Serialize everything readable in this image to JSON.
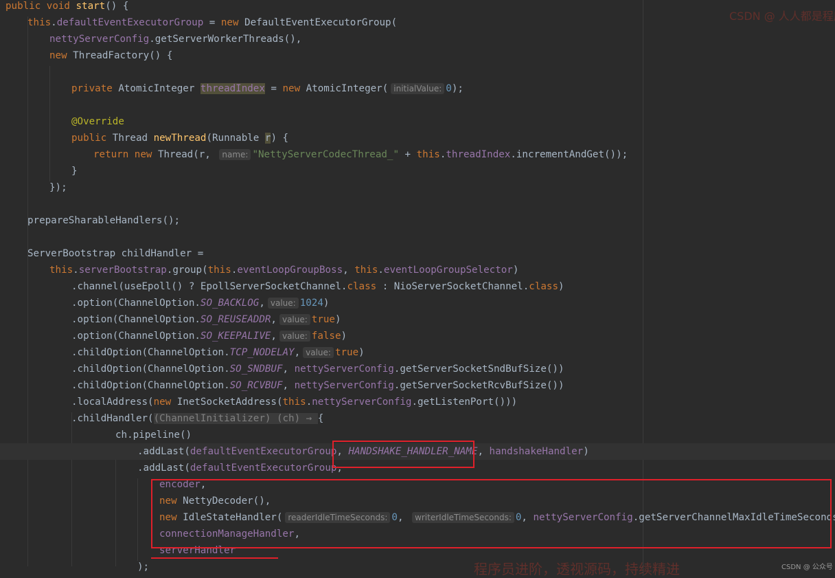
{
  "hints": {
    "initialValue": "initialValue:",
    "name": "name:",
    "value": "value:",
    "readerIdle": "readerIdleTimeSeconds:",
    "writerIdle": "writerIdleTimeSeconds:"
  },
  "tok": {
    "public": "public",
    "void": "void",
    "this": "this",
    "new": "new",
    "private": "private",
    "return": "return",
    "class": "class",
    "true": "true",
    "false": "false",
    "zero": "0",
    "n1024": "1024"
  },
  "code": {
    "l1": {
      "start": "start",
      "rest": "() {"
    },
    "l2": {
      "f": "defaultEventExecutorGroup",
      "mid": " = ",
      "rest": " DefaultEventExecutorGroup("
    },
    "l3": {
      "f": "nettyServerConfig",
      "rest": ".getServerWorkerThreads(),"
    },
    "l4": {
      "rest": " ThreadFactory() {"
    },
    "l6": {
      "type": " AtomicInteger ",
      "f": "threadIndex",
      "mid": " = ",
      "rest": " AtomicInteger(",
      "end": ");"
    },
    "l8": {
      "ann": "@Override"
    },
    "l9": {
      "type": " Thread ",
      "m": "newThread",
      "a": "(Runnable ",
      "r": "r",
      "b": ") {"
    },
    "l10": {
      "a": " Thread(r, ",
      "str": "\"NettyServerCodecThread_\"",
      "b": " + ",
      "f": "threadIndex",
      "c": ".incrementAndGet());"
    },
    "l11": {
      "t": "}"
    },
    "l12": {
      "t": "});"
    },
    "l14": {
      "t": "prepareSharableHandlers();"
    },
    "l16": {
      "t": "ServerBootstrap childHandler ="
    },
    "l17": {
      "f1": "serverBootstrap",
      "a": ".group(",
      "f2": "eventLoopGroupBoss",
      "b": ", ",
      "f3": "eventLoopGroupSelector",
      "c": ")"
    },
    "l18": {
      "a": ".channel(useEpoll() ? EpollServerSocketChannel.",
      "b": " : NioServerSocketChannel.",
      "c": ")"
    },
    "l19": {
      "a": ".option(ChannelOption.",
      "sf": "SO_BACKLOG",
      "b": ",",
      "c": ")"
    },
    "l20": {
      "a": ".option(ChannelOption.",
      "sf": "SO_REUSEADDR",
      "b": ",",
      "c": ")"
    },
    "l21": {
      "a": ".option(ChannelOption.",
      "sf": "SO_KEEPALIVE",
      "b": ",",
      "c": ")"
    },
    "l22": {
      "a": ".childOption(ChannelOption.",
      "sf": "TCP_NODELAY",
      "b": ",",
      "c": ")"
    },
    "l23": {
      "a": ".childOption(ChannelOption.",
      "sf": "SO_SNDBUF",
      "b": ", ",
      "f": "nettyServerConfig",
      "c": ".getServerSocketSndBufSize())"
    },
    "l24": {
      "a": ".childOption(ChannelOption.",
      "sf": "SO_RCVBUF",
      "b": ", ",
      "f": "nettyServerConfig",
      "c": ".getServerSocketRcvBufSize())"
    },
    "l25": {
      "a": ".localAddress(",
      "b": " InetSocketAddress(",
      "c": ".",
      "f": "nettyServerConfig",
      "d": ".getListenPort()))"
    },
    "l26": {
      "a": ".childHandler(",
      "fold": "(ChannelInitializer) (ch) → ",
      "b": "{"
    },
    "l27": {
      "t": "ch.pipeline()"
    },
    "l28": {
      "a": ".addLast(",
      "f": "defaultEventExecutorGroup",
      "b": ", ",
      "sf": "HANDSHAKE_HANDLER_NAME",
      "c": ", ",
      "f2": "handshakeHandler",
      "d": ")"
    },
    "l29": {
      "a": ".addLast(",
      "f": "defaultEventExecutorGroup",
      "b": ","
    },
    "l30": {
      "f": "encoder",
      "b": ","
    },
    "l31": {
      "b": " NettyDecoder(),"
    },
    "l32": {
      "a": " IdleStateHandler(",
      "b": ", ",
      "c": ", ",
      "f": "nettyServerConfig",
      "d": ".getServerChannelMaxIdleTimeSeconds()),"
    },
    "l33": {
      "f": "connectionManageHandler",
      "b": ","
    },
    "l34": {
      "f": "serverHandler"
    },
    "l35": {
      "t": ");"
    }
  },
  "watermark": {
    "top": "CSDN @ 人人都是程序员",
    "bottom": "程序员进阶，透视源码，持续精进",
    "bottom_small": "CSDN @ 公众号"
  }
}
